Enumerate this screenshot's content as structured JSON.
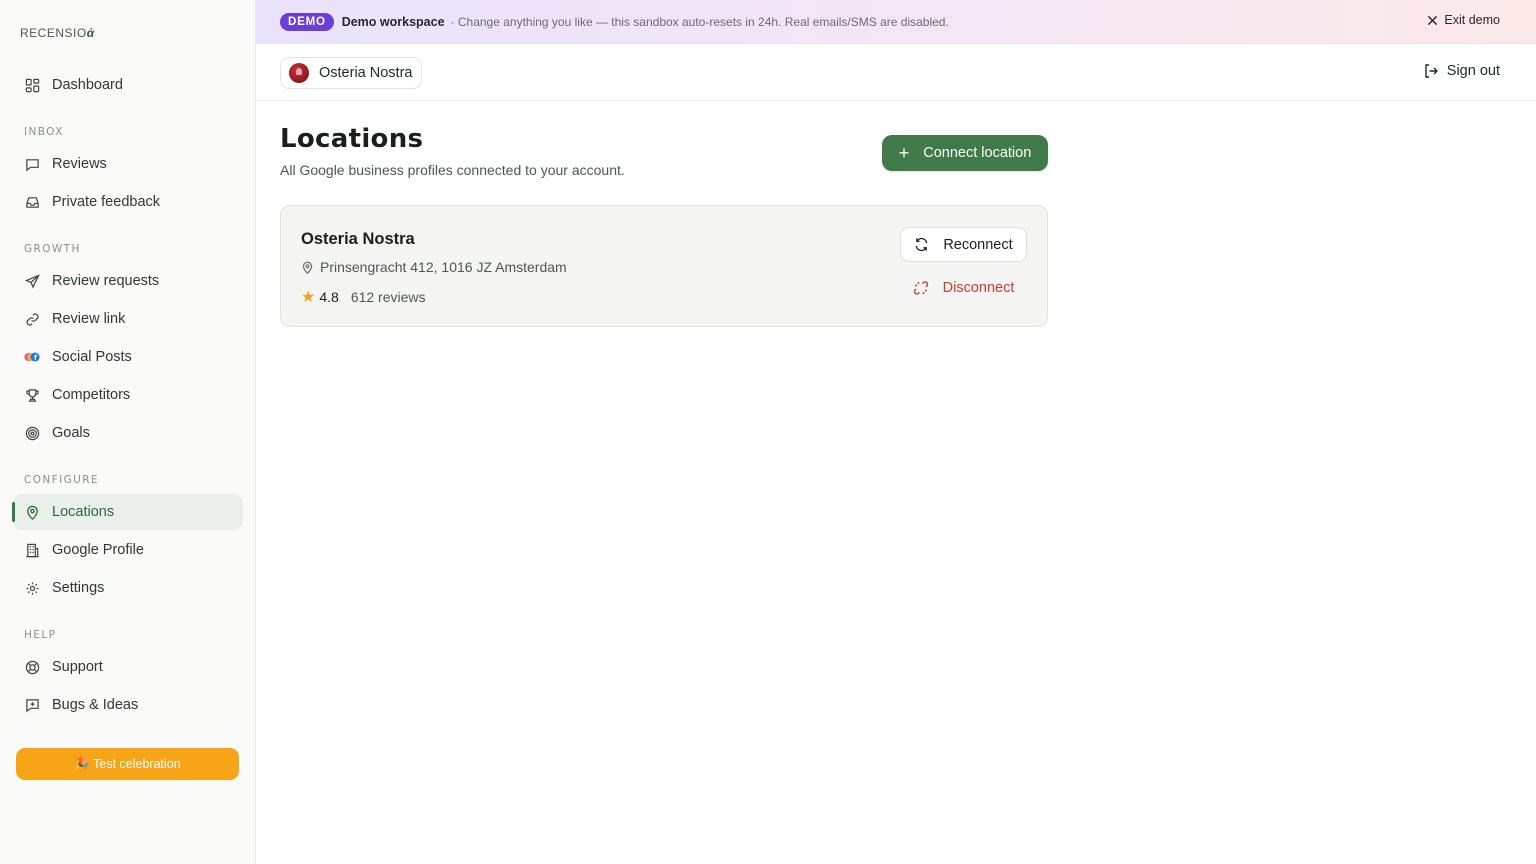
{
  "app": {
    "logo_text": "RECENSIO",
    "logo_mark": "ά"
  },
  "sidebar": {
    "dashboard": "Dashboard",
    "sections": {
      "inbox": "INBOX",
      "growth": "GROWTH",
      "configure": "CONFIGURE",
      "help": "HELP"
    },
    "items": {
      "reviews": "Reviews",
      "private_feedback": "Private feedback",
      "review_requests": "Review requests",
      "review_link": "Review link",
      "social_posts": "Social Posts",
      "competitors": "Competitors",
      "goals": "Goals",
      "locations": "Locations",
      "google_profile": "Google Profile",
      "settings": "Settings",
      "support": "Support",
      "bugs_ideas": "Bugs & Ideas"
    },
    "active_item": "locations",
    "celebration_button": "🎉 Test celebration"
  },
  "banner": {
    "badge": "DEMO",
    "title": "Demo workspace",
    "message": "· Change anything you like — this sandbox auto-resets in 24h. Real emails/SMS are disabled.",
    "exit_label": "Exit demo"
  },
  "topbar": {
    "location_name": "Osteria Nostra",
    "signout_label": "Sign out"
  },
  "main": {
    "title": "Locations",
    "subtitle": "All Google business profiles connected to your account.",
    "connect_button": "Connect location",
    "locations": [
      {
        "name": "Osteria Nostra",
        "address": "Prinsengracht 412, 1016 JZ Amsterdam",
        "rating": "4.8",
        "reviews": "612 reviews",
        "reconnect_label": "Reconnect",
        "disconnect_label": "Disconnect"
      }
    ]
  },
  "colors": {
    "accent": "#3f7a48",
    "demo_badge": "#6b3fd6",
    "celebration": "#f7a416",
    "danger": "#d23a2f",
    "star": "#f3a417"
  }
}
